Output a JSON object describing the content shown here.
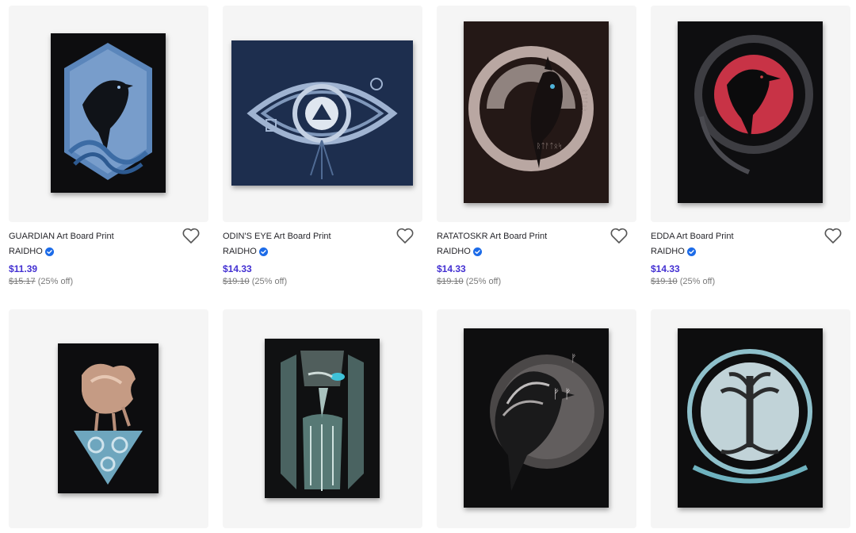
{
  "products": [
    {
      "title": "GUARDIAN Art Board Print",
      "artist": "RAIDHO",
      "price": "$11.39",
      "original_price": "$15.17",
      "discount": "(25% off)",
      "artwork": "raven-hexagon-blue"
    },
    {
      "title": "ODIN'S EYE Art Board Print",
      "artist": "RAIDHO",
      "price": "$14.33",
      "original_price": "$19.10",
      "discount": "(25% off)",
      "artwork": "odins-eye-navy"
    },
    {
      "title": "RATATOSKR Art Board Print",
      "artist": "RAIDHO",
      "price": "$14.33",
      "original_price": "$19.10",
      "discount": "(25% off)",
      "artwork": "squirrel-moon"
    },
    {
      "title": "EDDA Art Board Print",
      "artist": "RAIDHO",
      "price": "$14.33",
      "original_price": "$19.10",
      "discount": "(25% off)",
      "artwork": "raven-red-moon"
    },
    {
      "artwork": "sleipnir-horse"
    },
    {
      "artwork": "odin-face"
    },
    {
      "artwork": "raven-runes"
    },
    {
      "artwork": "yggdrasil-tree"
    }
  ],
  "colors": {
    "price": "#4330d2",
    "verified_badge": "#1c6be8",
    "card_background": "#f5f5f5"
  },
  "icons": {
    "favorite": "heart-outline-icon",
    "verified": "verified-badge-icon"
  }
}
